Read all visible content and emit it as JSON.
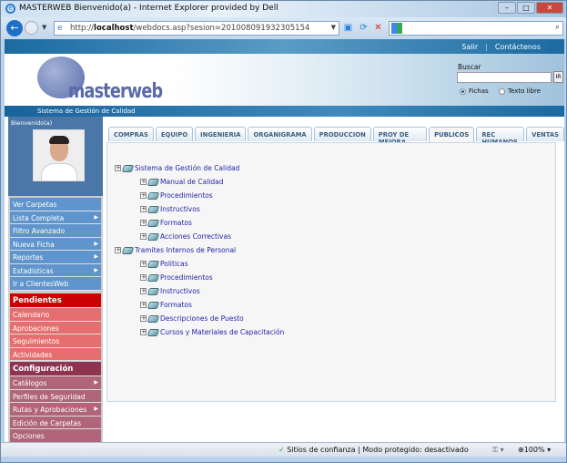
{
  "browser": {
    "title": "MASTERWEB Bienvenido(a) - Internet Explorer provided by Dell",
    "url_prefix": "http://",
    "url_host": "localhost",
    "url_path": "/webdocs.asp?sesion=201008091932305154"
  },
  "topbar": {
    "logout": "Salir",
    "contact": "Contáctenos"
  },
  "header": {
    "logo": "masterweb",
    "subtitle": "Sistema de Gestión de Calidad",
    "search_label": "Buscar",
    "search_value": "",
    "go": "IR",
    "radio_fichas": "Fichas",
    "radio_texto": "Texto libre",
    "selected": "Fichas"
  },
  "profile": {
    "welcome": "Bienvenido(a)"
  },
  "menu_main": [
    {
      "label": "Ver Carpetas",
      "sub": false
    },
    {
      "label": "Lista Completa",
      "sub": true
    },
    {
      "label": "Filtro Avanzado",
      "sub": false
    },
    {
      "label": "Nueva Ficha",
      "sub": true
    },
    {
      "label": "Reportes",
      "sub": true
    },
    {
      "label": "Estadisticas",
      "sub": true
    },
    {
      "label": "Ir a ClientesWeb",
      "sub": false
    }
  ],
  "pendientes": {
    "title": "Pendientes",
    "items": [
      "Calendario",
      "Aprobaciones",
      "Seguimientos",
      "Actividades"
    ]
  },
  "configuracion": {
    "title": "Configuración",
    "items": [
      {
        "label": "Catálogos",
        "sub": true
      },
      {
        "label": "Perfiles de Seguridad",
        "sub": false
      },
      {
        "label": "Rutas y Aprobaciones",
        "sub": true
      },
      {
        "label": "Edición de Carpetas",
        "sub": false
      },
      {
        "label": "Opciones",
        "sub": false
      }
    ]
  },
  "tabs": [
    "COMPRAS",
    "EQUIPO",
    "INGENIERIA",
    "ORGANIGRAMA",
    "PRODUCCION",
    "PROY DE MEJORA",
    "PUBLICOS",
    "REC HUMANOS",
    "VENTAS"
  ],
  "active_tab": "PUBLICOS",
  "tree": [
    {
      "label": "Sistema de Gestión de Calidad",
      "children": [
        "Manual de Calidad",
        "Procedimientos",
        "Instructivos",
        "Formatos",
        "Acciones Correctivas"
      ]
    },
    {
      "label": "Tramites Internos de Personal",
      "children": [
        "Politicas",
        "Procedimientos",
        "Instructivos",
        "Formatos",
        "Descripciones de Puesto",
        "Cursos y Materiales de Capacitación"
      ]
    }
  ],
  "status": {
    "trust": "Sitios de confianza | Modo protegido: desactivado",
    "zoom": "100%"
  }
}
